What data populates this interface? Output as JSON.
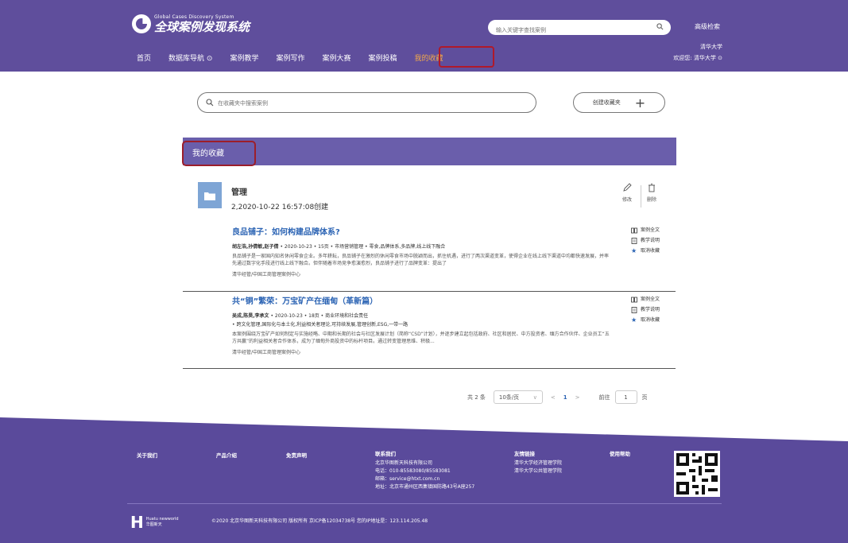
{
  "header": {
    "logo_en": "Global Cases Discovery System",
    "logo_cn": "全球案例发现系统",
    "search_placeholder": "输入关键字查找案例",
    "advanced_search": "高级检索",
    "nav": [
      "首页",
      "数据库导航",
      "案例教学",
      "案例写作",
      "案例大赛",
      "案例投稿",
      "我的收藏"
    ],
    "active_nav": "我的收藏",
    "user_org": "清华大学",
    "welcome": "欢迎您: 清华大学"
  },
  "toolbar": {
    "folder_search_placeholder": "在收藏夹中搜索案例",
    "create_folder": "创建收藏夹"
  },
  "section_title": "我的收藏",
  "folder": {
    "name": "管理",
    "meta": "2,2020-10-22 16:57:08创建",
    "edit_label": "修改",
    "delete_label": "删除"
  },
  "cases": [
    {
      "title": "良品铺子：如何构建品牌体系?",
      "authors": "胡左浩,孙倩敏,赵子倩",
      "meta": " • 2020-10-23 • 15页 • 市场营销管理 • 零食,品牌体系,多品牌,线上线下融合",
      "abstract": "良品铺子是一家国内知名休闲零食企业。多年耕耘，良品铺子在激烈的休闲零食市场中脱颖而出，抓住机遇，进行了两次渠道变革，使得企业在线上线下渠道中均都快速发展，并率先通过数字化手段进行线上线下融合。但伴随着市场竞争愈演愈烈，良品铺子进行了品牌变革：提出了",
      "source": "清华经管/中国工商管理案例中心",
      "actions": [
        "案例全文",
        "教学说明",
        "取消收藏"
      ]
    },
    {
      "title": "共“铜”繁荣：万宝矿产在缅甸（革新篇）",
      "authors": "吴成,陈昊,李承文",
      "meta": " • 2020-10-23 • 18页 • 商业环境和社会责任",
      "tags": "• 跨文化管理,国际化与本土化,利益相关者理论,可持续发展,管理创新,ESG,一带一路",
      "abstract": "本案例围绕万宝矿产如何制定与实施经略、中期和长期的社会与社区发展计划（简称“CSD”计划），并逐步建立起包括政府、社区和居民、中方投资者、缅方合作伙伴、企业员工“五方共赢”的利益相关者合作体系，成为了缅甸外商投资中的标杆项目。通过转变管理思维、积极...",
      "source": "清华经管/中国工商管理案例中心",
      "actions": [
        "案例全文",
        "教学说明",
        "取消收藏"
      ]
    }
  ],
  "pager": {
    "total": "共 2 条",
    "page_size": "10条/页",
    "current": "1",
    "goto_label": "前往",
    "goto_value": "1",
    "page_unit": "页",
    "prev": "<",
    "next": ">"
  },
  "footer": {
    "about": "关于我们",
    "product": "产品介绍",
    "disclaimer": "免责声明",
    "contact_title": "联系我们",
    "contact_company": "北京华图新天科技有限公司",
    "contact_phone": "电话：010-85583080/85583081",
    "contact_email": "邮箱：service@htxt.com.cn",
    "contact_address": "地址：北京市通州区西集镇国防路43号A座257",
    "links_title": "友情链接",
    "link1": "清华大学经济管理学院",
    "link2": "清华大学公共管理学院",
    "help": "使用帮助",
    "brand_en": "Huatu newworld",
    "brand_cn": "华图新天",
    "copyright": "©2020 北京华图新天科技有限公司 版权所有 京ICP备12034738号 您的IP地址是：123.114.205.48"
  },
  "colors": {
    "header_bg": "#5f4e9c",
    "band_bg": "#6a5eab",
    "accent_orange": "#f2a94a",
    "link_blue": "#2c64b4",
    "highlight_red": "#b0192a"
  }
}
